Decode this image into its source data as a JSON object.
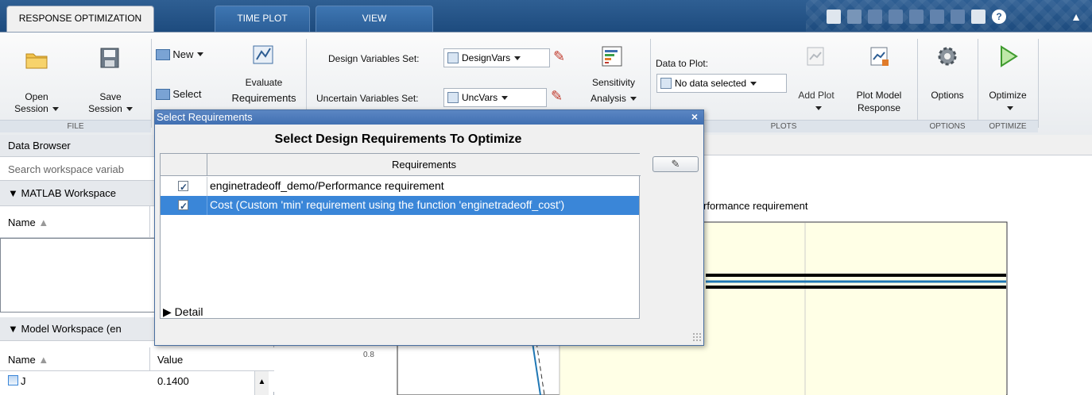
{
  "tabs": {
    "response_optimization": "RESPONSE OPTIMIZATION",
    "time_plot": "TIME PLOT",
    "view": "VIEW"
  },
  "ribbon": {
    "file": {
      "open_line1": "Open",
      "open_line2": "Session",
      "save_line1": "Save",
      "save_line2": "Session",
      "group_label": "FILE"
    },
    "requirements": {
      "new_label": "New",
      "select_label": "Select",
      "evaluate_line1": "Evaluate",
      "evaluate_line2": "Requirements"
    },
    "design_vars": {
      "label": "Design Variables Set:",
      "value": "DesignVars"
    },
    "uncertain_vars": {
      "label": "Uncertain Variables Set:",
      "value": "UncVars"
    },
    "sensitivity": {
      "line1": "Sensitivity",
      "line2": "Analysis"
    },
    "plots": {
      "data_to_plot_label": "Data to Plot:",
      "data_to_plot_value": "No data selected",
      "add_plot_label": "Add Plot",
      "plot_model_line1": "Plot Model",
      "plot_model_line2": "Response",
      "group_label": "PLOTS"
    },
    "options": {
      "label": "Options",
      "group_label": "OPTIONS"
    },
    "optimize": {
      "label": "Optimize",
      "group_label": "OPTIMIZE"
    }
  },
  "left_panel": {
    "title": "Data Browser",
    "search_placeholder": "Search workspace variab",
    "matlab_workspace": "MATLAB Workspace",
    "name_header": "Name",
    "model_workspace": "Model Workspace (en",
    "name_header2": "Name",
    "value_header": "Value",
    "var_name": "J",
    "var_value": "0.1400"
  },
  "plot": {
    "title_fragment": "rformance requirement",
    "tick_label": "0.8"
  },
  "dialog": {
    "title": "Select Requirements",
    "heading": "Select Design Requirements To Optimize",
    "column_header": "Requirements",
    "rows": [
      {
        "label": "enginetradeoff_demo/Performance requirement",
        "checked": true
      },
      {
        "label": "Cost (Custom 'min' requirement using the function 'enginetradeoff_cost')",
        "checked": true
      }
    ],
    "detail_label": "Detail",
    "close_glyph": "×"
  },
  "colors": {
    "tab_bar": "#2f5f93",
    "selection": "#3a86d8",
    "plot_bg": "#ffffe6"
  }
}
